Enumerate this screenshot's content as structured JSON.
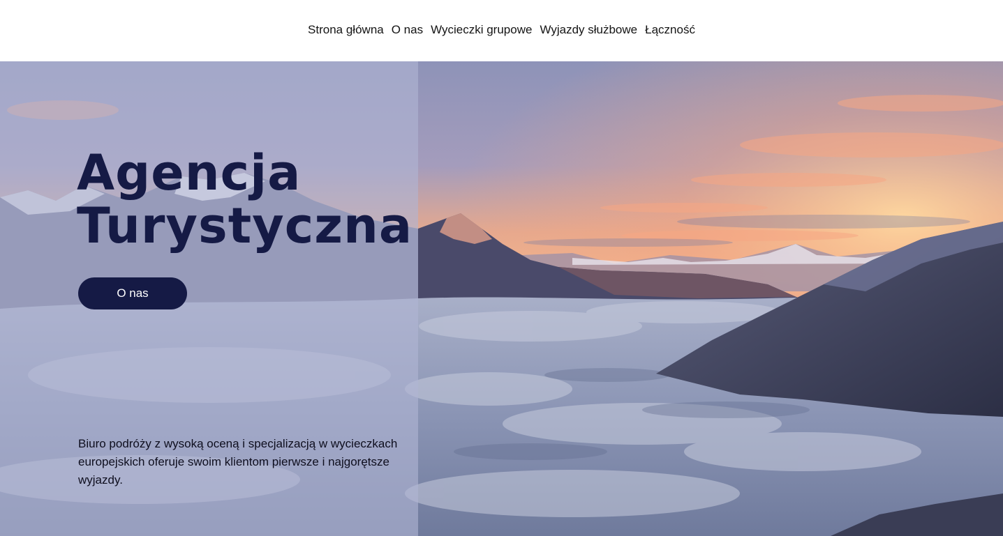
{
  "nav": {
    "items": [
      {
        "label": "Strona główna"
      },
      {
        "label": "O nas"
      },
      {
        "label": "Wycieczki grupowe"
      },
      {
        "label": "Wyjazdy służbowe"
      },
      {
        "label": "Łączność"
      }
    ]
  },
  "hero": {
    "title_line1": "Agencja",
    "title_line2": "Turystyczna",
    "cta_label": "O nas",
    "description": "Biuro podróży z wysoką oceną i specjalizacją w wycieczkach europejskich oferuje swoim klientom pierwsze i najgorętsze wyjazdy.",
    "image_subject": "mountain-sea-of-clouds-sunset"
  },
  "colors": {
    "brand_navy": "#151a45",
    "overlay": "#b0b4d4",
    "sky_peach": "#f4a77e",
    "cloud_gray": "#8a94b4"
  }
}
